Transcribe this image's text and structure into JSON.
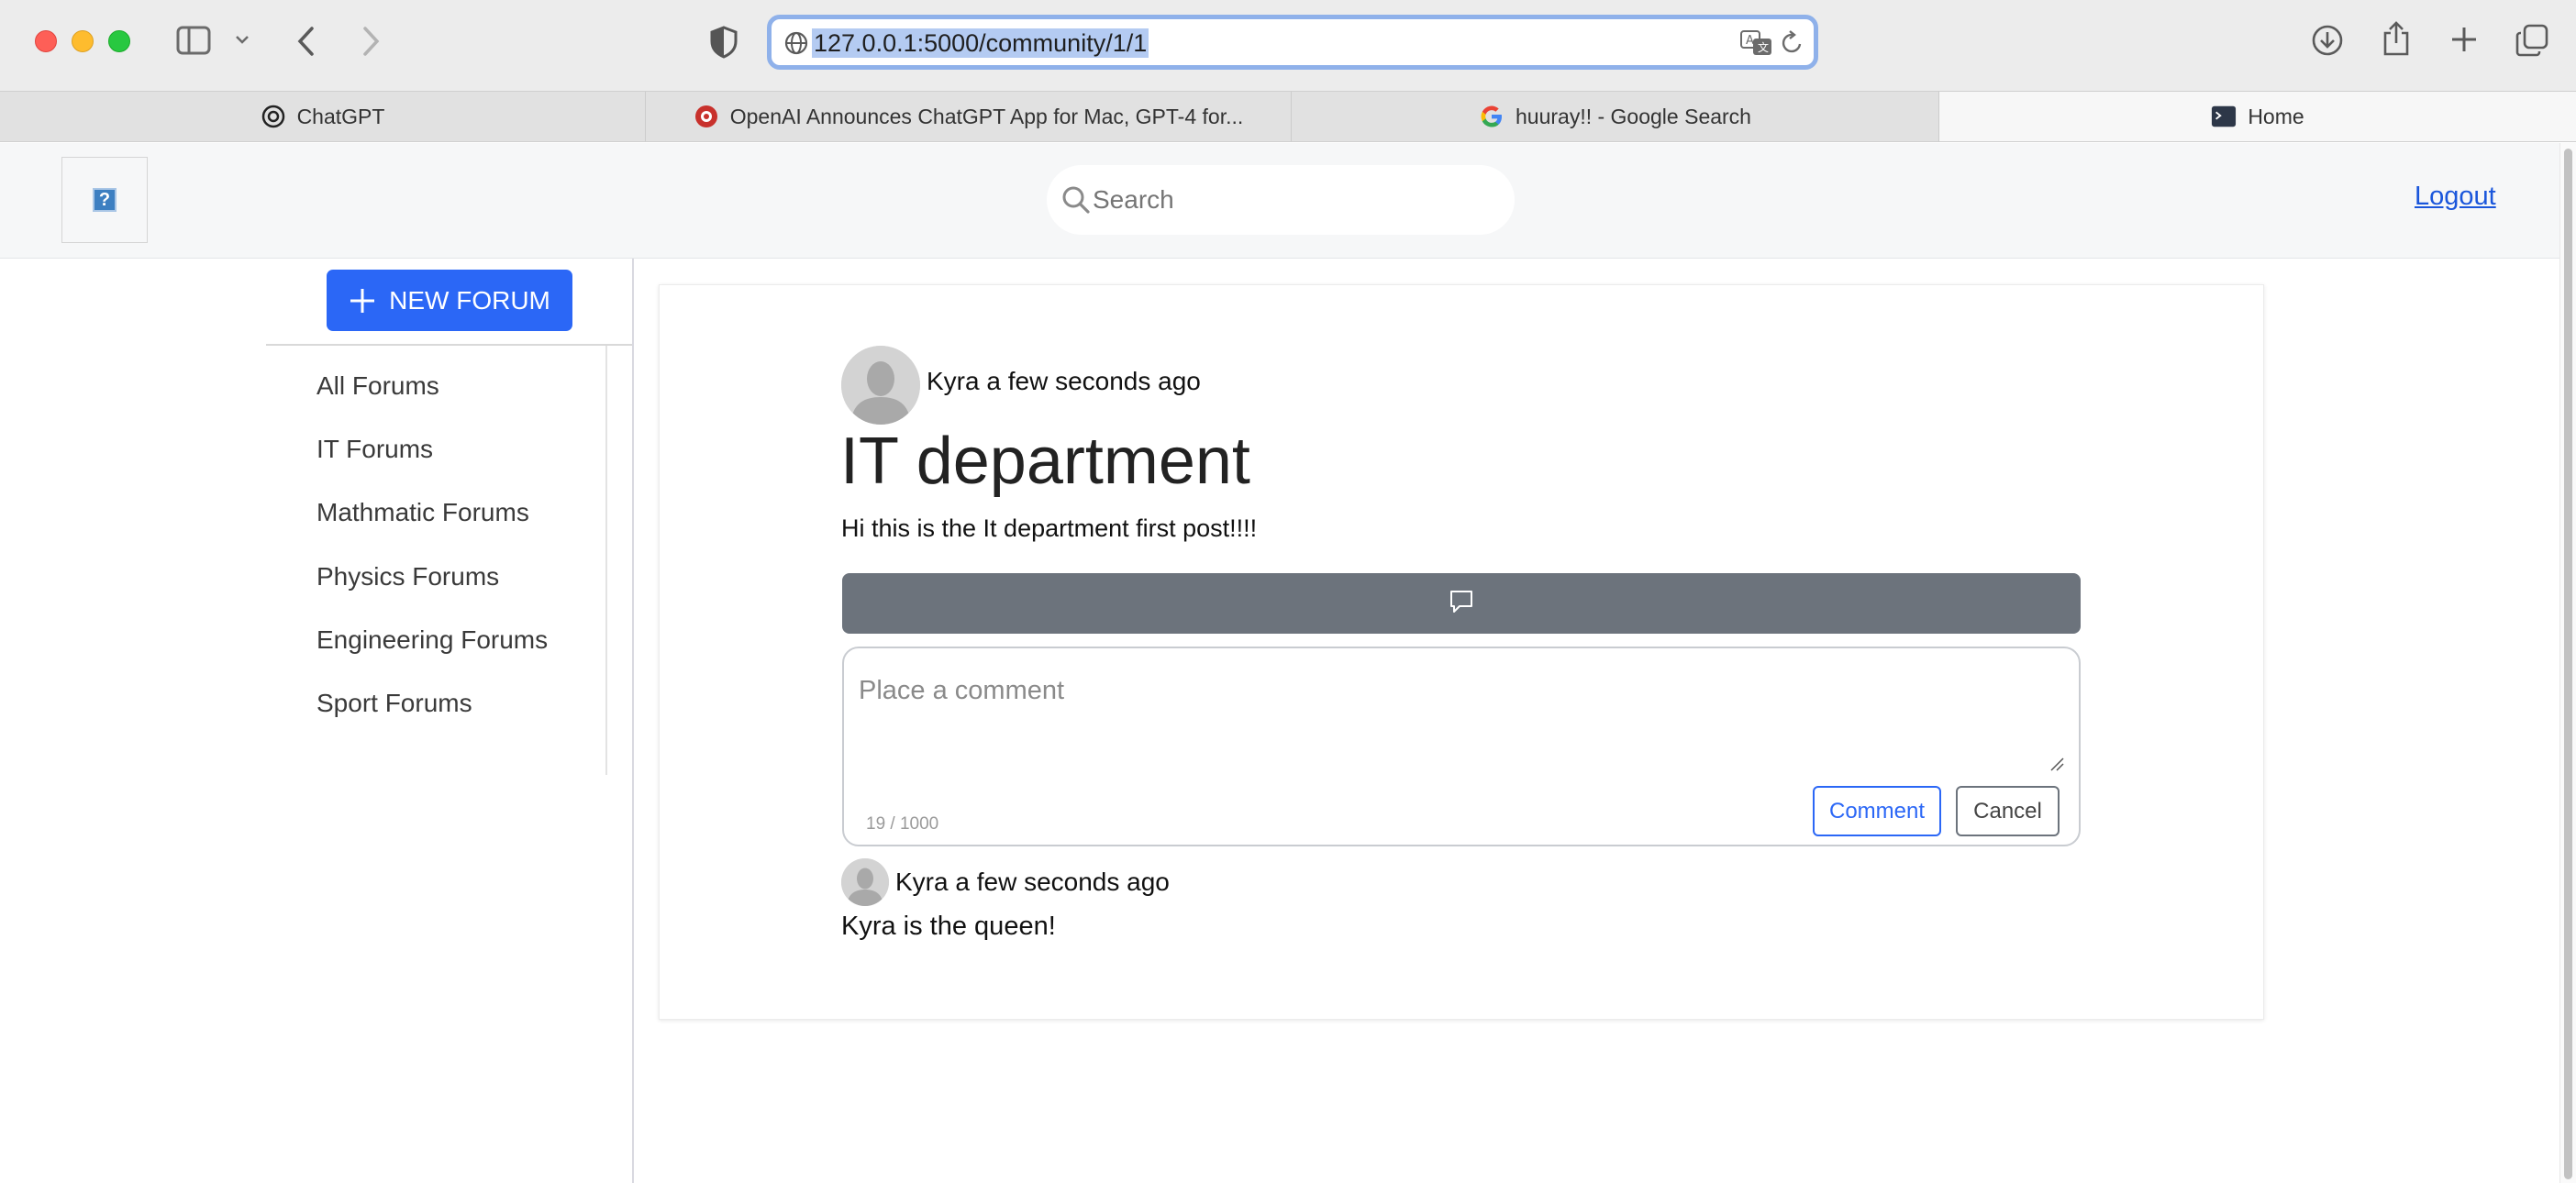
{
  "browser": {
    "url": "127.0.0.1:5000/community/1/1",
    "tabs": [
      {
        "label": "ChatGPT",
        "favicon": "openai-icon"
      },
      {
        "label": "OpenAI Announces ChatGPT App for Mac, GPT-4 for...",
        "favicon": "news-site-icon"
      },
      {
        "label": "huuray!! - Google Search",
        "favicon": "google-icon"
      },
      {
        "label": "Home",
        "favicon": "terminal-icon",
        "active": true
      }
    ]
  },
  "header": {
    "logo_icon": "broken-image-icon",
    "logo_glyph": "?",
    "search_placeholder": "Search",
    "logout_label": "Logout"
  },
  "sidebar": {
    "new_forum_label": "NEW FORUM",
    "forums": [
      "All Forums",
      "IT Forums",
      "Mathmatic Forums",
      "Physics Forums",
      "Engineering Forums",
      "Sport Forums"
    ]
  },
  "post": {
    "author": "Kyra",
    "time": "a few seconds ago",
    "title": "IT department",
    "body": "Hi this is the It department first post!!!!"
  },
  "comment_form": {
    "placeholder": "Place a comment",
    "char_count": "19 / 1000",
    "comment_label": "Comment",
    "cancel_label": "Cancel"
  },
  "comments": [
    {
      "author": "Kyra",
      "time": "a few seconds ago",
      "text": "Kyra is the queen!"
    }
  ],
  "colors": {
    "primary": "#2b67f6",
    "toggle_bar": "#6c737c",
    "link": "#1a56db"
  }
}
